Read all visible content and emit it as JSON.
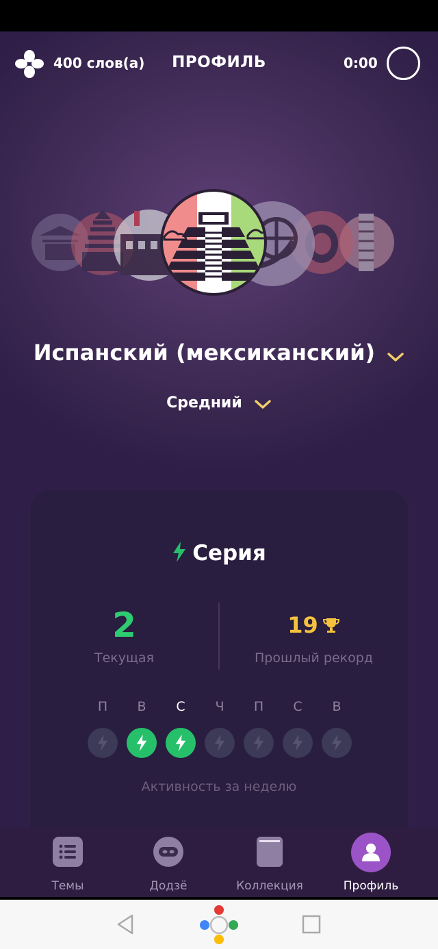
{
  "header": {
    "words_count": "400 слов(а)",
    "title": "ПРОФИЛЬ",
    "timer": "0:00"
  },
  "language": {
    "name": "Испанский (мексиканский)",
    "level": "Средний"
  },
  "streak": {
    "title": "Серия",
    "current_value": "2",
    "current_label": "Текущая",
    "record_value": "19",
    "record_label": "Прошлый рекорд",
    "days": [
      {
        "letter": "П",
        "active": false
      },
      {
        "letter": "В",
        "active": true
      },
      {
        "letter": "С",
        "active": true,
        "today": true
      },
      {
        "letter": "Ч",
        "active": false
      },
      {
        "letter": "П",
        "active": false
      },
      {
        "letter": "С",
        "active": false
      },
      {
        "letter": "В",
        "active": false
      }
    ],
    "caption": "Активность за неделю"
  },
  "nav": {
    "items": [
      {
        "label": "Темы",
        "icon": "list-icon"
      },
      {
        "label": "Додзё",
        "icon": "ninja-icon"
      },
      {
        "label": "Коллекция",
        "icon": "book-icon"
      },
      {
        "label": "Профиль",
        "icon": "person-icon",
        "active": true
      }
    ]
  },
  "colors": {
    "accent_green": "#27c06a",
    "gold": "#f5c23e",
    "chevron": "#f3cf6a",
    "nav_active": "#9b54c7"
  }
}
